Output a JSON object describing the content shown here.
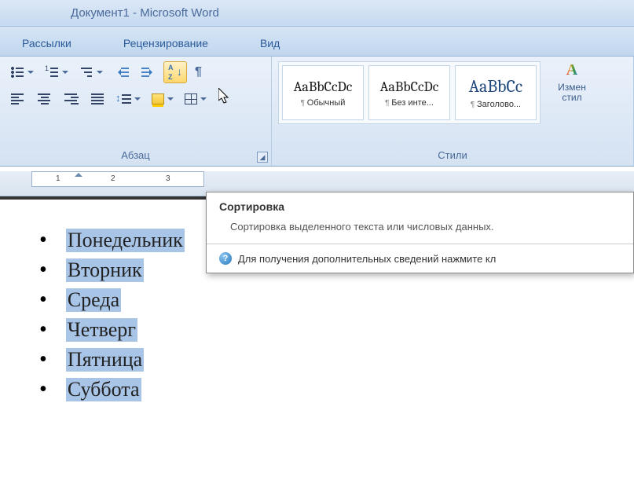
{
  "title": "Документ1 - Microsoft Word",
  "tabs": {
    "mailings": "Рассылки",
    "review": "Рецензирование",
    "view": "Вид"
  },
  "groups": {
    "paragraph": "Абзац",
    "styles": "Стили"
  },
  "styles_gallery": {
    "preview": "AaBbCcDc",
    "preview_heading": "AaBbCc",
    "items": [
      "Обычный",
      "Без инте...",
      "Заголово..."
    ]
  },
  "change_styles": {
    "line1": "Измен",
    "line2": "стил"
  },
  "tooltip": {
    "title": "Сортировка",
    "body": "Сортировка выделенного текста или числовых данных.",
    "help": "Для получения дополнительных сведений нажмите кл"
  },
  "ruler": {
    "marks": [
      "1",
      "2",
      "3"
    ]
  },
  "document": {
    "items": [
      "Понедельник",
      "Вторник",
      "Среда",
      "Четверг",
      "Пятница",
      "Суббота"
    ]
  }
}
